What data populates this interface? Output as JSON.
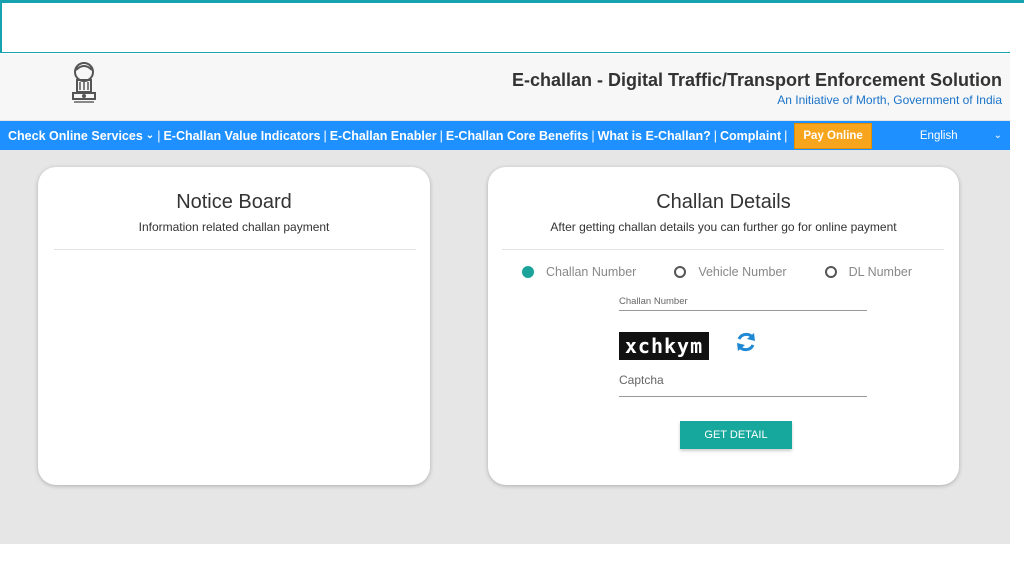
{
  "header": {
    "title": "E-challan - Digital Traffic/Transport Enforcement Solution",
    "subtitle": "An Initiative of Morth, Government of India"
  },
  "nav": {
    "items": [
      {
        "label": "Check Online Services"
      },
      {
        "label": "E-Challan Value Indicators"
      },
      {
        "label": "E-Challan Enabler"
      },
      {
        "label": "E-Challan Core Benefits"
      },
      {
        "label": "What is E-Challan?"
      },
      {
        "label": "Complaint"
      }
    ],
    "separator": "|",
    "pay_label": "Pay Online",
    "language": "English"
  },
  "notice": {
    "title": "Notice Board",
    "subtitle": "Information related challan payment"
  },
  "challan": {
    "title": "Challan Details",
    "subtitle": "After getting challan details you can further go for online payment",
    "radios": [
      {
        "label": "Challan Number",
        "checked": true
      },
      {
        "label": "Vehicle Number",
        "checked": false
      },
      {
        "label": "DL Number",
        "checked": false
      }
    ],
    "field_label": "Challan Number",
    "captcha_text": "xchkym",
    "captcha_placeholder": "Captcha",
    "button_label": "GET DETAIL"
  },
  "colors": {
    "nav_bg": "#1e90ff",
    "accent": "#17a89d",
    "pay_btn": "#f7a51c",
    "subtitle_link": "#1a73c9"
  }
}
